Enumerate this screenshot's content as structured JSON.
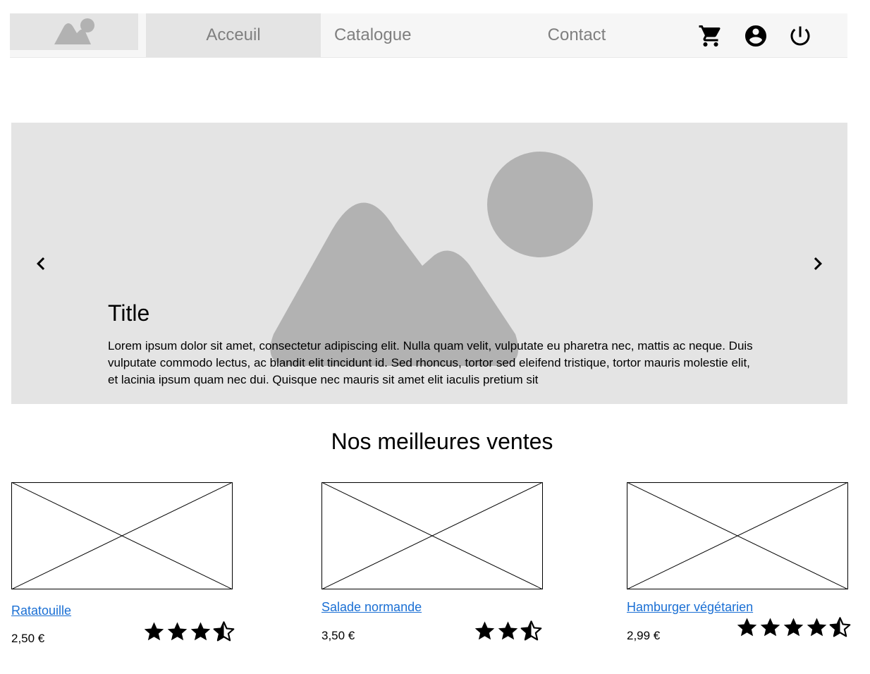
{
  "nav": {
    "items": [
      {
        "label": "Acceuil",
        "active": true
      },
      {
        "label": "Catalogue",
        "active": false
      },
      {
        "label": "Contact",
        "active": false
      }
    ],
    "icons": [
      "cart-icon",
      "account-icon",
      "power-icon"
    ]
  },
  "hero": {
    "title": "Title",
    "text": "Lorem ipsum dolor sit amet, consectetur adipiscing elit. Nulla quam velit, vulputate eu pharetra nec, mattis ac neque. Duis vulputate commodo lectus, ac blandit elit tincidunt id. Sed rhoncus, tortor sed eleifend tristique, tortor mauris molestie elit, et lacinia ipsum quam nec dui. Quisque nec mauris sit amet elit iaculis pretium sit",
    "icons": [
      "chevron-left-icon",
      "chevron-right-icon"
    ]
  },
  "bestsellers": {
    "title": "Nos meilleures ventes",
    "products": [
      {
        "name": "Ratatouille",
        "price": "2,50 €",
        "rating": 3.5,
        "max_rating": 4
      },
      {
        "name": "Salade normande",
        "price": "3,50 €",
        "rating": 2.5,
        "max_rating": 3
      },
      {
        "name": "Hamburger végétarien",
        "price": "2,99 €",
        "rating": 4.5,
        "max_rating": 5
      }
    ]
  },
  "colors": {
    "placeholder": "#e4e4e4",
    "placeholder_shape": "#b2b2b2",
    "nav_bg": "#f6f6f6",
    "link": "#1a6fd4"
  }
}
